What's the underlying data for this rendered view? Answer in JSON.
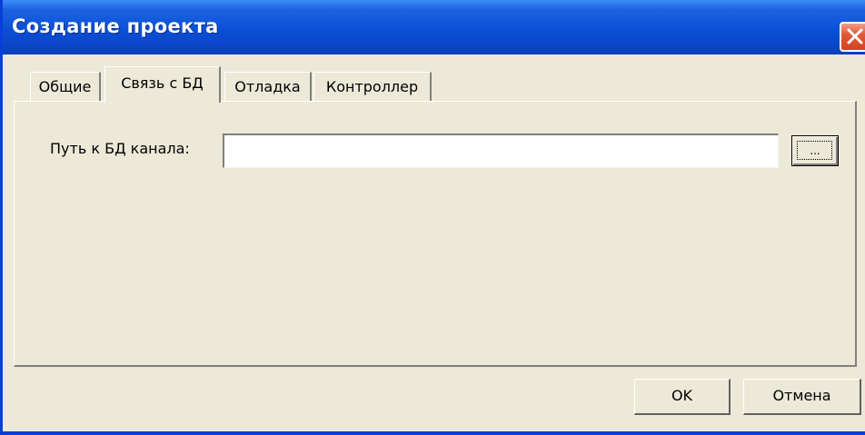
{
  "window": {
    "title": "Создание проекта"
  },
  "tabs": [
    {
      "label": "Общие",
      "active": false
    },
    {
      "label": "Связь с БД",
      "active": true
    },
    {
      "label": "Отладка",
      "active": false
    },
    {
      "label": "Контроллер",
      "active": false
    }
  ],
  "form": {
    "path_label": "Путь к БД канала:",
    "path_value": "",
    "browse_label": "..."
  },
  "buttons": {
    "ok_label": "OK",
    "cancel_label": "Отмена"
  },
  "colors": {
    "titlebar": "#0a4fd6",
    "dialog_bg": "#ece9d8",
    "close_button": "#e15a3a"
  },
  "icons": {
    "close": "close-icon"
  }
}
